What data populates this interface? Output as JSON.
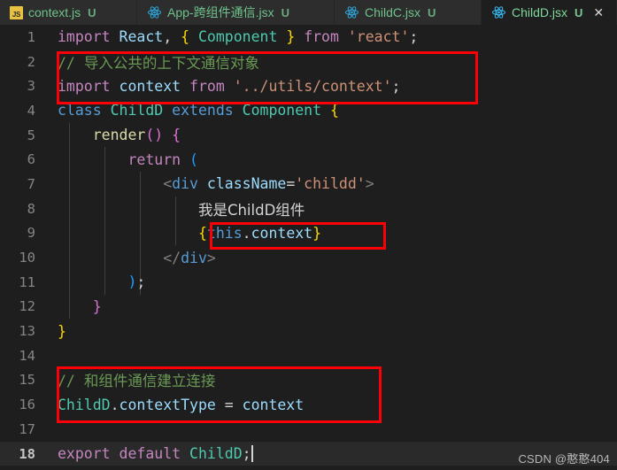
{
  "window": {
    "app": "Visual Studio Code",
    "theme_bg": "#1e1e1e",
    "accent_annotation": "#fb0007"
  },
  "tabs": [
    {
      "icon": "js-file-icon",
      "icon_text": "JS",
      "label": "context.js",
      "dirty": "U",
      "active": false,
      "closable": false
    },
    {
      "icon": "react-file-icon",
      "icon_text": "",
      "label": "App-跨组件通信.jsx",
      "dirty": "U",
      "active": false,
      "closable": false
    },
    {
      "icon": "react-file-icon",
      "icon_text": "",
      "label": "ChildC.jsx",
      "dirty": "U",
      "active": false,
      "closable": false
    },
    {
      "icon": "react-file-icon",
      "icon_text": "",
      "label": "ChildD.jsx",
      "dirty": "U",
      "active": true,
      "closable": true,
      "close_glyph": "✕"
    }
  ],
  "editor": {
    "filename": "ChildD.jsx",
    "language": "javascriptreact",
    "total_lines": 18,
    "current_line": 18,
    "lines": [
      {
        "n": "1",
        "text": "import React, { Component } from 'react';"
      },
      {
        "n": "2",
        "text": "// 导入公共的上下文通信对象"
      },
      {
        "n": "3",
        "text": "import context from '../utils/context';"
      },
      {
        "n": "4",
        "text": "class ChildD extends Component {"
      },
      {
        "n": "5",
        "text": "    render() {"
      },
      {
        "n": "6",
        "text": "        return ("
      },
      {
        "n": "7",
        "text": "            <div className='childd'>"
      },
      {
        "n": "8",
        "text": "                我是ChildD组件"
      },
      {
        "n": "9",
        "text": "                {this.context}"
      },
      {
        "n": "10",
        "text": "            </div>"
      },
      {
        "n": "11",
        "text": "        );"
      },
      {
        "n": "12",
        "text": "    }"
      },
      {
        "n": "13",
        "text": "}"
      },
      {
        "n": "14",
        "text": ""
      },
      {
        "n": "15",
        "text": "// 和组件通信建立连接"
      },
      {
        "n": "16",
        "text": "ChildD.contextType = context"
      },
      {
        "n": "17",
        "text": ""
      },
      {
        "n": "18",
        "text": "export default ChildD;"
      }
    ]
  },
  "annotations": [
    {
      "name": "import-context-highlight",
      "covers_lines": "2-3"
    },
    {
      "name": "this-context-highlight",
      "covers_lines": "9"
    },
    {
      "name": "contexttype-highlight",
      "covers_lines": "15-16"
    }
  ],
  "watermark": {
    "text": "CSDN @憨憨404"
  }
}
